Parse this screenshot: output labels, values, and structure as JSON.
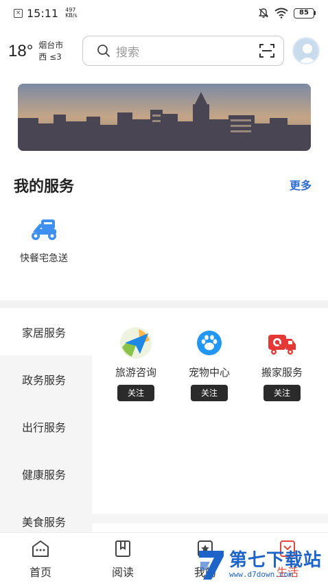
{
  "status_bar": {
    "time": "15:11",
    "net_speed_value": "497",
    "net_speed_unit": "KB/s",
    "battery": "85"
  },
  "header": {
    "temperature": "18°",
    "city": "烟台市",
    "wind": "西 ≤3",
    "search_placeholder": "搜索"
  },
  "my_services": {
    "title": "我的服务",
    "more_label": "更多",
    "items": [
      {
        "label": "快餐宅急送",
        "icon": "scooter-icon",
        "color": "#3d8ff0"
      }
    ]
  },
  "categories": [
    {
      "label": "家居服务",
      "selected": true
    },
    {
      "label": "政务服务",
      "selected": false
    },
    {
      "label": "出行服务",
      "selected": false
    },
    {
      "label": "健康服务",
      "selected": false
    },
    {
      "label": "美食服务",
      "selected": false
    }
  ],
  "apps": [
    {
      "label": "旅游咨询",
      "button": "关注",
      "icon": "paper-plane-icon"
    },
    {
      "label": "宠物中心",
      "button": "关注",
      "icon": "paw-icon"
    },
    {
      "label": "搬家服务",
      "button": "关注",
      "icon": "truck-icon"
    }
  ],
  "bottom_nav": [
    {
      "label": "首页",
      "icon": "home-icon",
      "active": false
    },
    {
      "label": "阅读",
      "icon": "book-icon",
      "active": false
    },
    {
      "label": "我的",
      "icon": "star-icon",
      "active": false
    },
    {
      "label": "生活",
      "icon": "life-icon",
      "active": true
    }
  ],
  "watermark": {
    "text": "第七下载站",
    "url": "www.d7down.com"
  },
  "colors": {
    "accent_blue": "#2d6cd2",
    "active_red": "#e0463c",
    "follow_button": "#2b2b2b"
  }
}
